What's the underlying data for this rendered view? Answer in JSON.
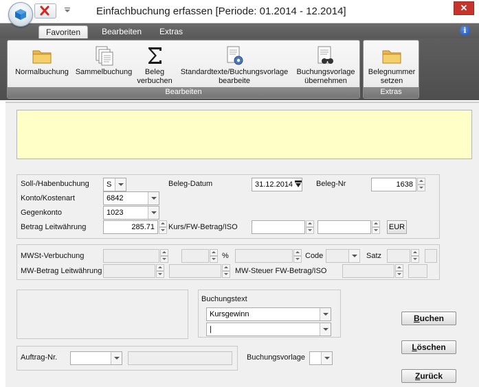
{
  "window": {
    "title": "Einfachbuchung erfassen  [Periode: 01.2014 - 12.2014]",
    "close_glyph": "✕"
  },
  "ribbon": {
    "tabs": [
      {
        "label": "Favoriten",
        "active": true
      },
      {
        "label": "Bearbeiten",
        "active": false
      },
      {
        "label": "Extras",
        "active": false
      }
    ],
    "help_glyph": "i",
    "groups": {
      "bearbeiten": {
        "caption": "Bearbeiten",
        "buttons": [
          {
            "label": "Normalbuchung",
            "icon": "folder-icon"
          },
          {
            "label": "Sammelbuchung",
            "icon": "documents-icon"
          },
          {
            "label": "Beleg\nverbuchen",
            "icon": "sigma-icon"
          },
          {
            "label": "Standardtexte/Buchungsvorlage\nbearbeite",
            "icon": "document-gear-icon"
          },
          {
            "label": "Buchungsvorlage\nübernehmen",
            "icon": "document-binoculars-icon"
          }
        ]
      },
      "extras": {
        "caption": "Extras",
        "buttons": [
          {
            "label": "Belegnummer\nsetzen",
            "icon": "folder-icon"
          }
        ]
      }
    }
  },
  "form": {
    "soll_haben": {
      "label": "Soll-/Habenbuchung",
      "value": "S"
    },
    "beleg_datum": {
      "label": "Beleg-Datum",
      "value": "31.12.2014"
    },
    "beleg_nr": {
      "label": "Beleg-Nr",
      "value": "1638"
    },
    "konto": {
      "label": "Konto/Kostenart",
      "value": "6842"
    },
    "gegenkonto": {
      "label": "Gegenkonto",
      "value": "1023"
    },
    "betrag": {
      "label": "Betrag Leitwährung",
      "value": "285.71"
    },
    "kurs": {
      "label": "Kurs/FW-Betrag/ISO",
      "value1": "",
      "value2": "",
      "iso": "EUR"
    },
    "mwst_verbuchung": {
      "label": "MWSt-Verbuchung",
      "value": ""
    },
    "percent": {
      "label": "%"
    },
    "code": {
      "label": "Code"
    },
    "satz": {
      "label": "Satz"
    },
    "mw_betrag": {
      "label": "MW-Betrag Leitwährung"
    },
    "mw_steuer_fw": {
      "label": "MW-Steuer FW-Betrag/ISO"
    },
    "buchungstext": {
      "label": "Buchungstext",
      "value1": "Kursgewinn",
      "value2": "|"
    },
    "auftrag": {
      "label": "Auftrag-Nr.",
      "value": ""
    },
    "buchungsvorlage": {
      "label": "Buchungsvorlage",
      "value": ""
    }
  },
  "buttons": {
    "buchen": {
      "underline": "B",
      "rest": "uchen"
    },
    "loeschen": {
      "underline": "L",
      "rest": "öschen"
    },
    "zurueck": {
      "underline": "Z",
      "rest": "urück"
    }
  },
  "colors": {
    "message_area": "#ffffc8",
    "ribbon_dark": "#585858",
    "close_red": "#c7342b"
  }
}
